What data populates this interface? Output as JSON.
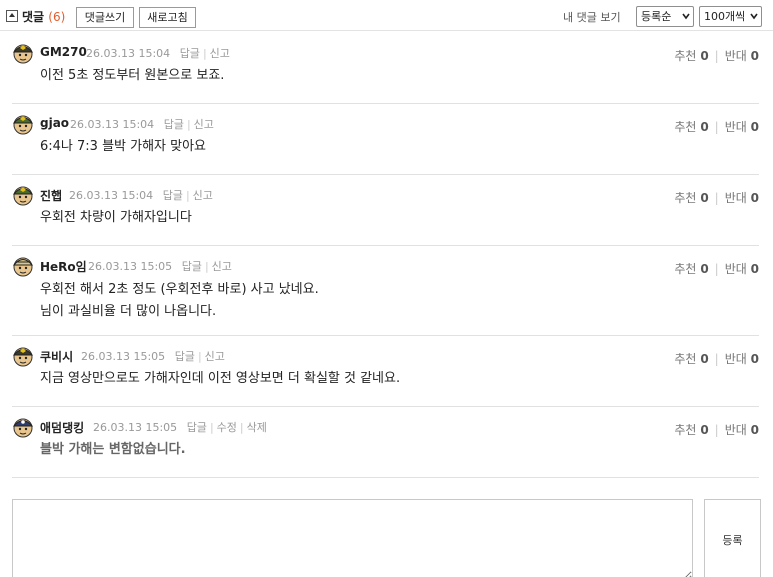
{
  "header": {
    "title": "댓글",
    "count": "(6)",
    "write_btn": "댓글쓰기",
    "refresh_btn": "새로고침",
    "my_comments": "내 댓글 보기",
    "sort_select": "등록순",
    "page_size_select": "100개씩"
  },
  "comments": [
    {
      "nick": "GM270",
      "date": "26.03.13 15:04",
      "actions": [
        "답글",
        "신고"
      ],
      "body": [
        "이전 5초 정도부터 원본으로 보죠."
      ],
      "up_label": "추천",
      "up": "0",
      "down_label": "반대",
      "down": "0"
    },
    {
      "nick": "gjao",
      "date": "26.03.13 15:04",
      "actions": [
        "답글",
        "신고"
      ],
      "body": [
        "6:4나 7:3 블박 가해자 맞아요"
      ],
      "up_label": "추천",
      "up": "0",
      "down_label": "반대",
      "down": "0"
    },
    {
      "nick": "진햅",
      "date": "26.03.13 15:04",
      "actions": [
        "답글",
        "신고"
      ],
      "body": [
        "우회전 차량이 가해자입니다"
      ],
      "up_label": "추천",
      "up": "0",
      "down_label": "반대",
      "down": "0"
    },
    {
      "nick": "HeRo임",
      "date": "26.03.13 15:05",
      "actions": [
        "답글",
        "신고"
      ],
      "body": [
        "우회전 해서 2초 정도 (우회전후 바로) 사고 났네요.",
        "님이 과실비율 더 많이 나옵니다."
      ],
      "up_label": "추천",
      "up": "0",
      "down_label": "반대",
      "down": "0"
    },
    {
      "nick": "쿠비시",
      "date": "26.03.13 15:05",
      "actions": [
        "답글",
        "신고"
      ],
      "body": [
        "지금 영상만으로도 가해자인데 이전 영상보면 더 확실할 것 같네요."
      ],
      "up_label": "추천",
      "up": "0",
      "down_label": "반대",
      "down": "0"
    },
    {
      "nick": "애덤댕킹",
      "date": "26.03.13 15:05",
      "actions": [
        "답글",
        "수정",
        "삭제"
      ],
      "body": [
        "블박 가해는 변함없습니다."
      ],
      "up_label": "추천",
      "up": "0",
      "down_label": "반대",
      "down": "0"
    }
  ],
  "form": {
    "submit_label": "등록",
    "textarea_value": ""
  }
}
